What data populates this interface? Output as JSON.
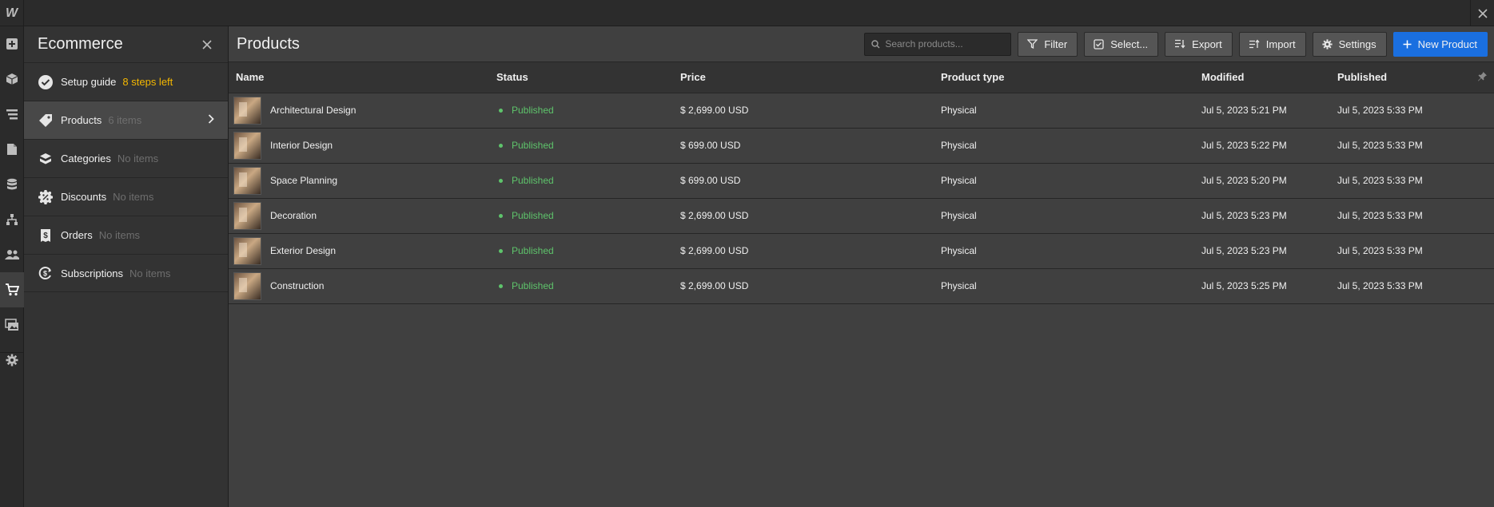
{
  "app": {
    "logo_letter": "W"
  },
  "rail": {
    "icons": [
      "add-icon",
      "box-icon",
      "navigator-icon",
      "pages-icon",
      "cms-icon",
      "logic-icon",
      "users-icon",
      "ecommerce-icon",
      "assets-icon",
      "settings-icon"
    ],
    "active": "ecommerce-icon"
  },
  "panel": {
    "title": "Ecommerce",
    "items": [
      {
        "label": "Setup guide",
        "meta": "8 steps left",
        "meta_style": "warn"
      },
      {
        "label": "Products",
        "meta": "6 items"
      },
      {
        "label": "Categories",
        "meta": "No items"
      },
      {
        "label": "Discounts",
        "meta": "No items"
      },
      {
        "label": "Orders",
        "meta": "No items"
      },
      {
        "label": "Subscriptions",
        "meta": "No items"
      }
    ]
  },
  "toolbar": {
    "title": "Products",
    "search_placeholder": "Search products...",
    "filter_label": "Filter",
    "select_label": "Select...",
    "export_label": "Export",
    "import_label": "Import",
    "settings_label": "Settings",
    "new_product_label": "New Product"
  },
  "table": {
    "columns": [
      "Name",
      "Status",
      "Price",
      "Product type",
      "Modified",
      "Published"
    ],
    "rows": [
      {
        "name": "Architectural Design",
        "status": "Published",
        "price": "$ 2,699.00 USD",
        "type": "Physical",
        "modified": "Jul 5, 2023 5:21 PM",
        "published": "Jul 5, 2023 5:33 PM"
      },
      {
        "name": "Interior Design",
        "status": "Published",
        "price": "$ 699.00 USD",
        "type": "Physical",
        "modified": "Jul 5, 2023 5:22 PM",
        "published": "Jul 5, 2023 5:33 PM"
      },
      {
        "name": "Space Planning",
        "status": "Published",
        "price": "$ 699.00 USD",
        "type": "Physical",
        "modified": "Jul 5, 2023 5:20 PM",
        "published": "Jul 5, 2023 5:33 PM"
      },
      {
        "name": "Decoration",
        "status": "Published",
        "price": "$ 2,699.00 USD",
        "type": "Physical",
        "modified": "Jul 5, 2023 5:23 PM",
        "published": "Jul 5, 2023 5:33 PM"
      },
      {
        "name": "Exterior Design",
        "status": "Published",
        "price": "$ 2,699.00 USD",
        "type": "Physical",
        "modified": "Jul 5, 2023 5:23 PM",
        "published": "Jul 5, 2023 5:33 PM"
      },
      {
        "name": "Construction",
        "status": "Published",
        "price": "$ 2,699.00 USD",
        "type": "Physical",
        "modified": "Jul 5, 2023 5:25 PM",
        "published": "Jul 5, 2023 5:33 PM"
      }
    ]
  },
  "colors": {
    "accent": "#1a6fe0",
    "published": "#5ec46b",
    "warning": "#f5b800",
    "background": "#404040",
    "panel": "#333333",
    "chrome": "#2b2b2b"
  }
}
